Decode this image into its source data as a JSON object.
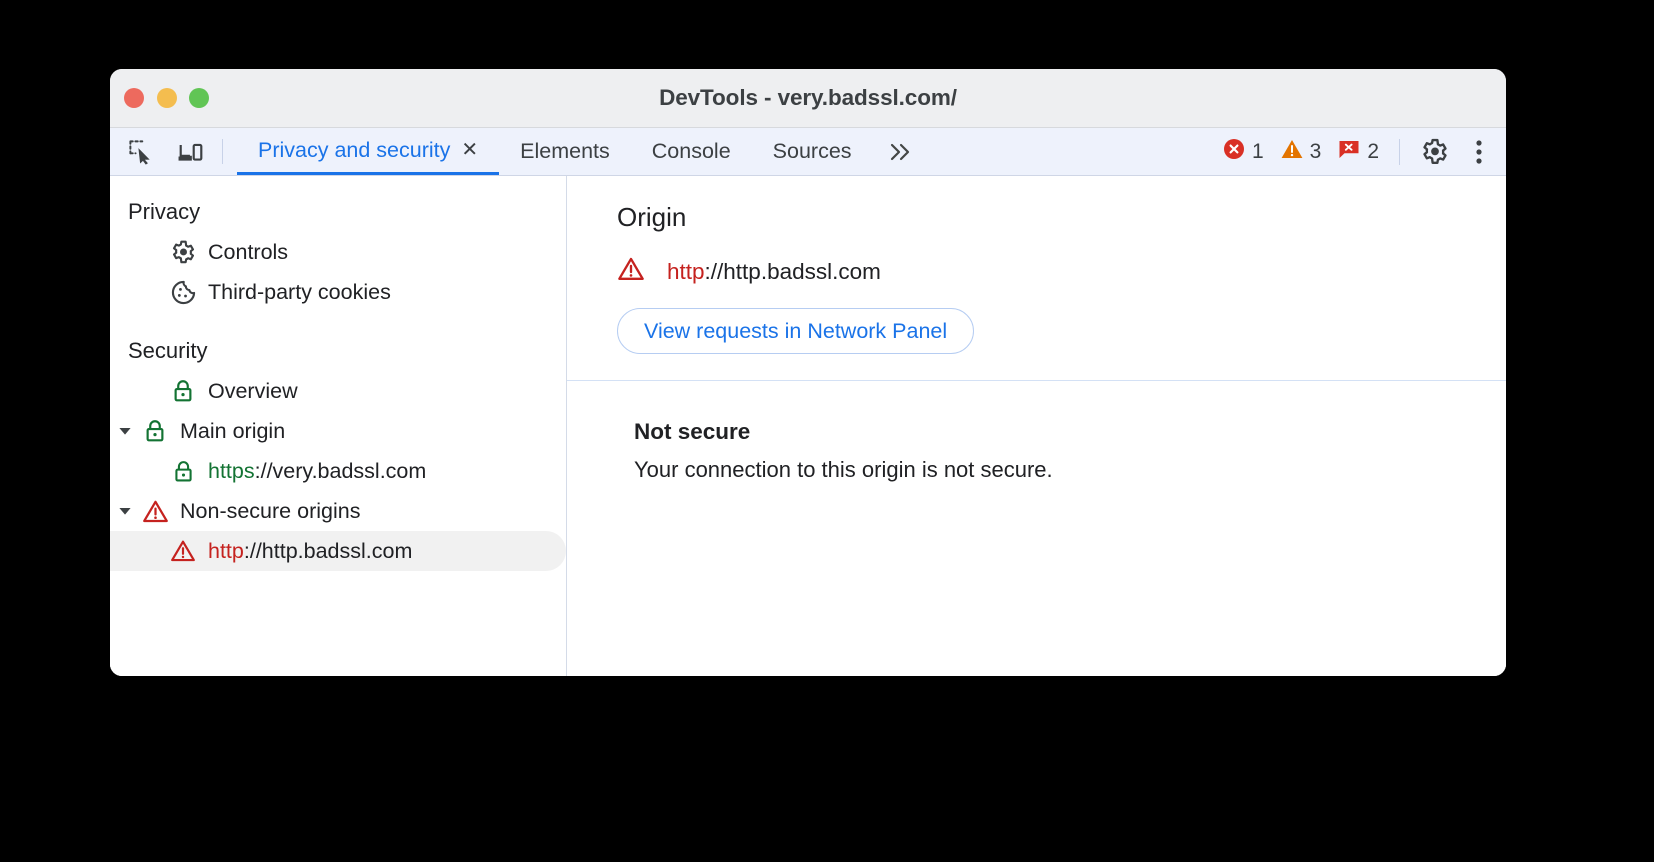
{
  "window": {
    "title": "DevTools - very.badssl.com/",
    "traffic_lights": [
      "close",
      "minimize",
      "maximize"
    ]
  },
  "toolbar": {
    "left_icons": [
      {
        "name": "inspect-element-icon",
        "label": "Inspect element"
      },
      {
        "name": "device-toolbar-icon",
        "label": "Toggle device toolbar"
      }
    ],
    "tabs": [
      {
        "label": "Privacy and security",
        "active": true,
        "closable": true
      },
      {
        "label": "Elements",
        "active": false,
        "closable": false
      },
      {
        "label": "Console",
        "active": false,
        "closable": false
      },
      {
        "label": "Sources",
        "active": false,
        "closable": false
      }
    ],
    "more_tabs_label": "»",
    "close_glyph": "✕",
    "counters": [
      {
        "name": "errors",
        "icon": "error-icon",
        "count": "1",
        "color": "#d93025"
      },
      {
        "name": "warnings",
        "icon": "warning-icon",
        "count": "3",
        "color": "#e37400"
      },
      {
        "name": "issues",
        "icon": "issue-icon",
        "count": "2",
        "color": "#d93025"
      }
    ],
    "settings_label": "Settings",
    "menu_label": "Customize and control DevTools"
  },
  "sidebar": {
    "groups": [
      {
        "title": "Privacy",
        "items": [
          {
            "label": "Controls",
            "icon": "gear-icon",
            "indent": 1,
            "selected": false
          },
          {
            "label": "Third-party cookies",
            "icon": "cookie-icon",
            "indent": 1,
            "selected": false
          }
        ]
      },
      {
        "title": "Security",
        "items": [
          {
            "label": "Overview",
            "icon": "lock-green-icon",
            "indent": 1,
            "selected": false
          },
          {
            "label": "Main origin",
            "icon": "lock-green-icon",
            "indent": 1,
            "twisty": true,
            "selected": false
          },
          {
            "label_scheme": "https",
            "label_rest": "://very.badssl.com",
            "icon": "lock-green-icon",
            "indent": 2,
            "scheme_color": "green",
            "selected": false
          },
          {
            "label": "Non-secure origins",
            "icon": "warning-triangle-icon",
            "indent": 1,
            "twisty": true,
            "selected": false
          },
          {
            "label_scheme": "http",
            "label_rest": "://http.badssl.com",
            "icon": "warning-triangle-icon",
            "indent": 2,
            "scheme_color": "red",
            "selected": true
          }
        ]
      }
    ]
  },
  "main": {
    "origin_section": {
      "heading": "Origin",
      "url_scheme": "http",
      "url_rest": "://http.badssl.com",
      "icon": "warning-triangle-icon",
      "button_label": "View requests in Network Panel"
    },
    "status_section": {
      "title": "Not secure",
      "body": "Your connection to this origin is not secure."
    }
  },
  "colors": {
    "accent_blue": "#1a73e8",
    "error_red": "#d93025",
    "warning_orange": "#e37400",
    "secure_green": "#137333",
    "insecure_red": "#c5221f"
  }
}
